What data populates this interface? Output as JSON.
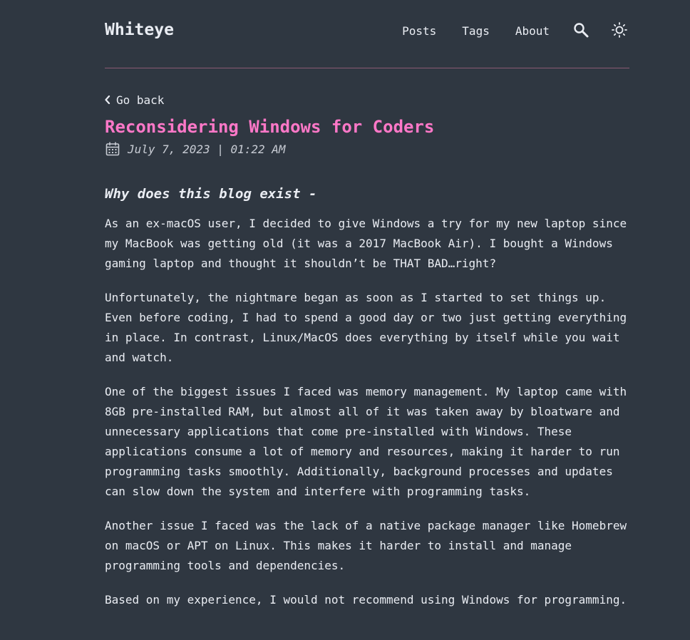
{
  "site": {
    "title": "Whiteye"
  },
  "nav": {
    "items": [
      "Posts",
      "Tags",
      "About"
    ],
    "search_icon": "search-icon",
    "theme_icon": "sun-icon"
  },
  "post": {
    "back_label": "Go back",
    "title": "Reconsidering Windows for Coders",
    "date": "July 7, 2023 | 01:22 AM",
    "section_heading": "Why does this blog exist -",
    "paragraphs": [
      "As an ex-macOS user, I decided to give Windows a try for my new laptop since my MacBook was getting old (it was a 2017 MacBook Air). I bought a Windows gaming laptop and thought it shouldn’t be THAT BAD…right?",
      "Unfortunately, the nightmare began as soon as I started to set things up. Even before coding, I had to spend a good day or two just getting everything in place. In contrast, Linux/MacOS does everything by itself while you wait and watch.",
      "One of the biggest issues I faced was memory management. My laptop came with 8GB pre-installed RAM, but almost all of it was taken away by bloatware and unnecessary applications that come pre-installed with Windows. These applications consume a lot of memory and resources, making it harder to run programming tasks smoothly. Additionally, background processes and updates can slow down the system and interfere with programming tasks.",
      "Another issue I faced was the lack of a native package manager like Homebrew on macOS or APT on Linux. This makes it harder to install and manage programming tools and dependencies.",
      "Based on my experience, I would not recommend using Windows for programming."
    ]
  },
  "colors": {
    "background": "#2f3741",
    "text": "#eaedf3",
    "accent": "#ff78c8",
    "divider": "#8a5a72"
  }
}
